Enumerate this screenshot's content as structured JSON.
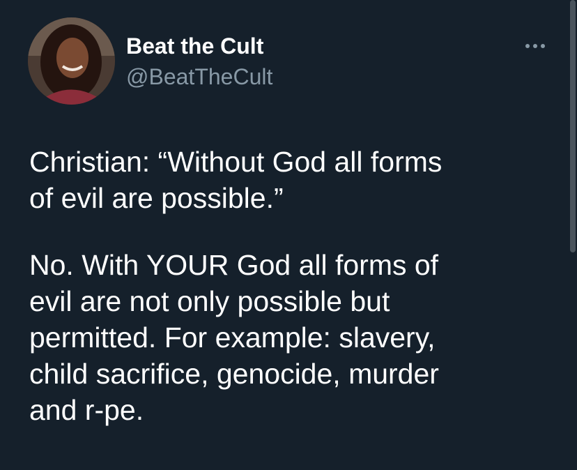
{
  "tweet": {
    "author": {
      "name": "Beat the Cult",
      "handle": "@BeatTheCult"
    },
    "more_icon": "ellipsis-icon",
    "paragraphs": [
      "Christian: “Without God all forms\nof evil are possible.”",
      "No. With YOUR God all forms of\nevil are not only possible but\npermitted. For example: slavery,\nchild sacrifice, genocide, murder\nand r-pe."
    ]
  },
  "colors": {
    "background": "#15202b",
    "text_primary": "#ffffff",
    "text_secondary": "#8899a6"
  }
}
